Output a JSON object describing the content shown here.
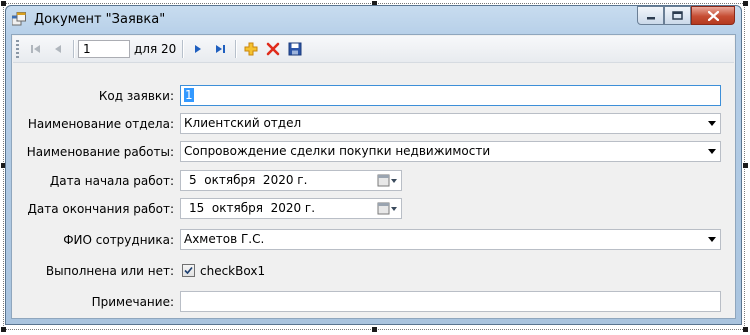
{
  "window": {
    "title": "Документ \"Заявка\"",
    "icon": "app-form-icon",
    "buttons": [
      "minimize",
      "maximize",
      "close"
    ]
  },
  "navigator": {
    "position": "1",
    "count_label": "для 20",
    "buttons": [
      "move-first",
      "move-previous",
      "move-next",
      "move-last",
      "add-new",
      "delete",
      "save"
    ]
  },
  "form": {
    "id_label": "Код заявки:",
    "id_value": "1",
    "department_label": "Наименование отдела:",
    "department_value": "Клиентский отдел",
    "work_label": "Наименование работы:",
    "work_value": "Сопровождение сделки покупки недвижимости",
    "start_label": "Дата начала работ:",
    "start_value": "5  октября  2020 г.",
    "end_label": "Дата окончания работ:",
    "end_value": "15  октября  2020 г.",
    "employee_label": "ФИО сотрудника:",
    "employee_value": "Ахметов Г.С.",
    "done_label": "Выполнена или нет:",
    "done_checkbox_text": "checkBox1",
    "done_checked": true,
    "note_label": "Примечание:",
    "note_value": ""
  },
  "colors": {
    "title_gradient_top": "#c8dcef",
    "client_bg": "#f0f0f0",
    "focus_border": "#3d8fd8",
    "selection": "#3399ff",
    "close_button": "#c64d33"
  }
}
